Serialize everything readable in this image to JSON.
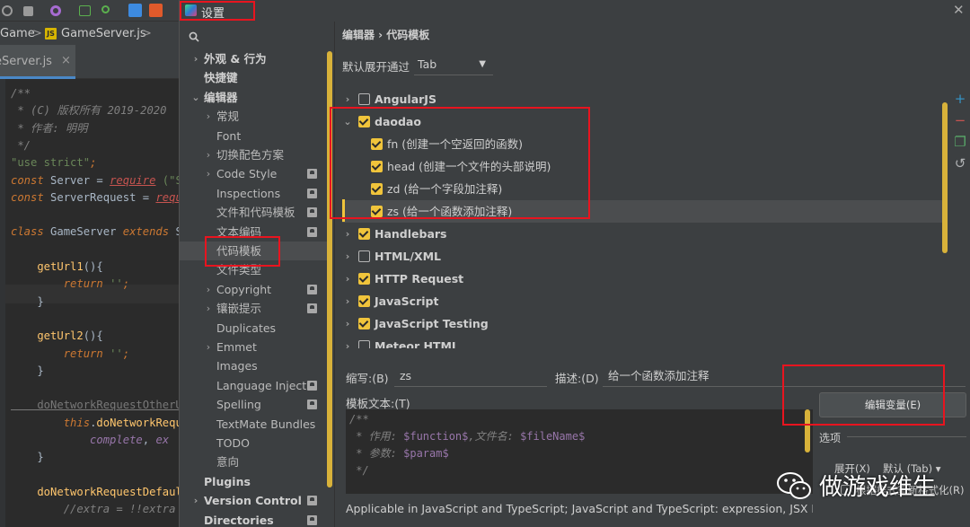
{
  "editor": {
    "breadcrumb": {
      "folder": "Game",
      "sep": ">",
      "file": "GameServer.js",
      "sep2": ">",
      "js_badge": "JS"
    },
    "tab": {
      "label": "eServer.js",
      "close": "×"
    },
    "code_lines": [
      {
        "parts": [
          {
            "t": "/**",
            "c": "c-com"
          }
        ]
      },
      {
        "parts": [
          {
            "t": " * (C) 版权所有 2019-2020",
            "c": "c-com"
          }
        ]
      },
      {
        "parts": [
          {
            "t": " * 作者: 明明",
            "c": "c-com"
          }
        ]
      },
      {
        "parts": [
          {
            "t": " */",
            "c": "c-com"
          }
        ]
      },
      {
        "parts": [
          {
            "t": "\"use strict\"",
            "c": "c-str"
          },
          {
            "t": ";",
            "c": "c-kw"
          }
        ]
      },
      {
        "parts": [
          {
            "t": "const ",
            "c": "c-kw"
          },
          {
            "t": "Server",
            "c": "c-txt"
          },
          {
            "t": " = ",
            "c": "c-txt"
          },
          {
            "t": "require",
            "c": "c-req"
          },
          {
            "t": " (\"S",
            "c": "c-str"
          }
        ]
      },
      {
        "parts": [
          {
            "t": "const ",
            "c": "c-kw"
          },
          {
            "t": "ServerRequest",
            "c": "c-txt"
          },
          {
            "t": " = ",
            "c": "c-txt"
          },
          {
            "t": "requ",
            "c": "c-req"
          }
        ]
      },
      {
        "parts": [
          {
            "t": "",
            "c": "c-txt"
          }
        ]
      },
      {
        "parts": [
          {
            "t": "class ",
            "c": "c-kw"
          },
          {
            "t": "GameServer ",
            "c": "c-txt"
          },
          {
            "t": "extends ",
            "c": "c-kw"
          },
          {
            "t": "Se",
            "c": "c-txt"
          }
        ]
      },
      {
        "parts": [
          {
            "t": "",
            "c": "c-txt"
          }
        ]
      },
      {
        "parts": [
          {
            "t": "    getUrl1",
            "c": "c-fn"
          },
          {
            "t": "(){",
            "c": "c-txt"
          }
        ]
      },
      {
        "parts": [
          {
            "t": "        return ",
            "c": "c-kw"
          },
          {
            "t": "''",
            "c": "c-str"
          },
          {
            "t": ";",
            "c": "c-kw"
          }
        ]
      },
      {
        "parts": [
          {
            "t": "    }",
            "c": "c-txt"
          }
        ]
      },
      {
        "parts": [
          {
            "t": "",
            "c": "c-txt"
          }
        ]
      },
      {
        "parts": [
          {
            "t": "    getUrl2",
            "c": "c-fn"
          },
          {
            "t": "(){",
            "c": "c-txt"
          }
        ]
      },
      {
        "parts": [
          {
            "t": "        return ",
            "c": "c-kw"
          },
          {
            "t": "''",
            "c": "c-str"
          },
          {
            "t": ";",
            "c": "c-kw"
          }
        ]
      },
      {
        "parts": [
          {
            "t": "    }",
            "c": "c-txt"
          }
        ]
      },
      {
        "parts": [
          {
            "t": "",
            "c": "c-txt"
          }
        ]
      },
      {
        "parts": [
          {
            "t": "    doNetworkRequestOtherU",
            "c": "c-dim"
          }
        ]
      },
      {
        "parts": [
          {
            "t": "        this",
            "c": "c-kw"
          },
          {
            "t": ".",
            "c": "c-txt"
          },
          {
            "t": "doNetworkRequ",
            "c": "c-fn"
          }
        ]
      },
      {
        "parts": [
          {
            "t": "            complete",
            "c": "c-pur"
          },
          {
            "t": ", ",
            "c": "c-txt"
          },
          {
            "t": "ex",
            "c": "c-pur"
          }
        ]
      },
      {
        "parts": [
          {
            "t": "    }",
            "c": "c-txt"
          }
        ]
      },
      {
        "parts": [
          {
            "t": "",
            "c": "c-txt"
          }
        ]
      },
      {
        "parts": [
          {
            "t": "    doNetworkRequestDefaul",
            "c": "c-fn"
          }
        ]
      },
      {
        "parts": [
          {
            "t": "        //extra = !!extra",
            "c": "c-com"
          }
        ]
      }
    ]
  },
  "dialog": {
    "title": "设置",
    "close": "✕",
    "search_placeholder": "",
    "tree": [
      {
        "label": "外观 & 行为",
        "arrow": "›",
        "indent": 0,
        "bold": true,
        "badge": false
      },
      {
        "label": "快捷键",
        "arrow": "",
        "indent": 0,
        "bold": true,
        "badge": false
      },
      {
        "label": "编辑器",
        "arrow": "⌄",
        "indent": 0,
        "bold": true,
        "badge": false
      },
      {
        "label": "常规",
        "arrow": "›",
        "indent": 1,
        "bold": false,
        "badge": false
      },
      {
        "label": "Font",
        "arrow": "",
        "indent": 1,
        "bold": false,
        "badge": false
      },
      {
        "label": "切换配色方案",
        "arrow": "›",
        "indent": 1,
        "bold": false,
        "badge": false
      },
      {
        "label": "Code Style",
        "arrow": "›",
        "indent": 1,
        "bold": false,
        "badge": true
      },
      {
        "label": "Inspections",
        "arrow": "",
        "indent": 1,
        "bold": false,
        "badge": true
      },
      {
        "label": "文件和代码模板",
        "arrow": "",
        "indent": 1,
        "bold": false,
        "badge": true
      },
      {
        "label": "文本编码",
        "arrow": "",
        "indent": 1,
        "bold": false,
        "badge": true
      },
      {
        "label": "代码模板",
        "arrow": "",
        "indent": 1,
        "bold": false,
        "badge": false,
        "selected": true
      },
      {
        "label": "文件类型",
        "arrow": "",
        "indent": 1,
        "bold": false,
        "badge": false
      },
      {
        "label": "Copyright",
        "arrow": "›",
        "indent": 1,
        "bold": false,
        "badge": true
      },
      {
        "label": "镶嵌提示",
        "arrow": "›",
        "indent": 1,
        "bold": false,
        "badge": true
      },
      {
        "label": "Duplicates",
        "arrow": "",
        "indent": 1,
        "bold": false,
        "badge": false
      },
      {
        "label": "Emmet",
        "arrow": "›",
        "indent": 1,
        "bold": false,
        "badge": false
      },
      {
        "label": "Images",
        "arrow": "",
        "indent": 1,
        "bold": false,
        "badge": false
      },
      {
        "label": "Language Injecti",
        "arrow": "",
        "indent": 1,
        "bold": false,
        "badge": true
      },
      {
        "label": "Spelling",
        "arrow": "",
        "indent": 1,
        "bold": false,
        "badge": true
      },
      {
        "label": "TextMate Bundles",
        "arrow": "",
        "indent": 1,
        "bold": false,
        "badge": false
      },
      {
        "label": "TODO",
        "arrow": "",
        "indent": 1,
        "bold": false,
        "badge": false
      },
      {
        "label": "意向",
        "arrow": "",
        "indent": 1,
        "bold": false,
        "badge": false
      },
      {
        "label": "Plugins",
        "arrow": "",
        "indent": 0,
        "bold": true,
        "badge": false
      },
      {
        "label": "Version Control",
        "arrow": "›",
        "indent": 0,
        "bold": true,
        "badge": true
      },
      {
        "label": "Directories",
        "arrow": "",
        "indent": 0,
        "bold": true,
        "badge": true
      }
    ],
    "breadcrumb": "编辑器  ›  代码模板",
    "expand_label": "默认展开通过",
    "expand_value": "Tab",
    "templates": [
      {
        "label": "AngularJS",
        "group": true,
        "checked": false,
        "arrow": "›",
        "indent": 0
      },
      {
        "label": "daodao",
        "group": true,
        "checked": true,
        "arrow": "⌄",
        "indent": 0
      },
      {
        "label": "fn (创建一个空返回的函数)",
        "group": false,
        "checked": true,
        "arrow": "",
        "indent": 1
      },
      {
        "label": "head (创建一个文件的头部说明)",
        "group": false,
        "checked": true,
        "arrow": "",
        "indent": 1
      },
      {
        "label": "zd (给一个字段加注释)",
        "group": false,
        "checked": true,
        "arrow": "",
        "indent": 1
      },
      {
        "label": "zs (给一个函数添加注释)",
        "group": false,
        "checked": true,
        "arrow": "",
        "indent": 1,
        "selected": true
      },
      {
        "label": "Handlebars",
        "group": true,
        "checked": true,
        "arrow": "›",
        "indent": 0
      },
      {
        "label": "HTML/XML",
        "group": true,
        "checked": false,
        "arrow": "›",
        "indent": 0
      },
      {
        "label": "HTTP Request",
        "group": true,
        "checked": true,
        "arrow": "›",
        "indent": 0
      },
      {
        "label": "JavaScript",
        "group": true,
        "checked": true,
        "arrow": "›",
        "indent": 0
      },
      {
        "label": "JavaScript Testing",
        "group": true,
        "checked": true,
        "arrow": "›",
        "indent": 0
      },
      {
        "label": "Meteor HTML",
        "group": true,
        "checked": false,
        "arrow": "›",
        "indent": 0
      }
    ],
    "side_tools": [
      {
        "name": "add-icon",
        "glyph": "+",
        "color": "#3592c4"
      },
      {
        "name": "remove-icon",
        "glyph": "−",
        "color": "#c75450"
      },
      {
        "name": "copy-icon",
        "glyph": "❐",
        "color": "#59a869"
      },
      {
        "name": "restore-icon",
        "glyph": "↺",
        "color": "#afb1b3"
      }
    ],
    "abbr_label": "缩写:(B)",
    "abbr_value": "zs",
    "desc_label": "描述:(D)",
    "desc_value": "给一个函数添加注释",
    "template_text_label": "模板文本:(T)",
    "template_text_lines": [
      [
        {
          "t": "/**",
          "v": false
        }
      ],
      [
        {
          "t": " * 作用: ",
          "v": false
        },
        {
          "t": "$function$",
          "v": true
        },
        {
          "t": ",文件名: ",
          "v": false
        },
        {
          "t": "$fileName$",
          "v": true
        }
      ],
      [
        {
          "t": " * 参数: ",
          "v": false
        },
        {
          "t": "$param$",
          "v": true
        }
      ],
      [
        {
          "t": " */",
          "v": false
        }
      ]
    ],
    "edit_vars_button": "编辑变量(E)",
    "options_label": "选项",
    "expand_with_label": "展开(X)",
    "expand_with_value": "默认 (Tab)   ▾",
    "reformat_label": "根据样式重新格式化(R)",
    "applicable_text": "Applicable in JavaScript and TypeScript; JavaScript and TypeScript: expression, JSX HTML"
  },
  "watermark": {
    "text": "做游戏维生"
  },
  "colors": {
    "accent": "#f0c43b",
    "highlight_red": "#e8141f",
    "background": "#3c3f41",
    "editor_bg": "#2b2b2b"
  }
}
